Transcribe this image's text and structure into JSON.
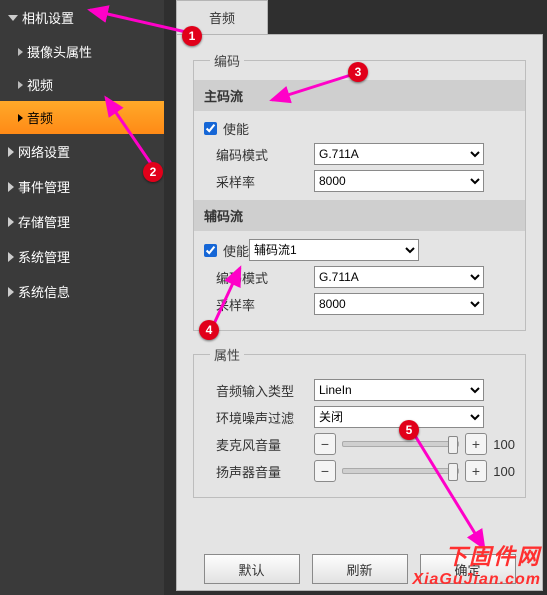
{
  "sidebar": {
    "group0": "相机设置",
    "g0c0": "摄像头属性",
    "g0c1": "视频",
    "g0c2": "音频",
    "group1": "网络设置",
    "group2": "事件管理",
    "group3": "存储管理",
    "group4": "系统管理",
    "group5": "系统信息"
  },
  "tab": {
    "audio": "音频"
  },
  "encoding": {
    "legend": "编码",
    "main": {
      "header": "主码流",
      "enable": "使能",
      "mode_label": "编码模式",
      "mode_value": "G.711A",
      "rate_label": "采样率",
      "rate_value": "8000"
    },
    "sub": {
      "header": "辅码流",
      "enable": "使能",
      "stream_value": "辅码流1",
      "mode_label": "编码模式",
      "mode_value": "G.711A",
      "rate_label": "采样率",
      "rate_value": "8000"
    }
  },
  "attrs": {
    "legend": "属性",
    "input_type_label": "音频输入类型",
    "input_type_value": "LineIn",
    "noise_label": "环境噪声过滤",
    "noise_value": "关闭",
    "mic_label": "麦克风音量",
    "mic_value": "100",
    "spk_label": "扬声器音量",
    "spk_value": "100",
    "minus": "−",
    "plus": "+"
  },
  "footer": {
    "default": "默认",
    "refresh": "刷新",
    "ok": "确定"
  },
  "markers": {
    "m1": "1",
    "m2": "2",
    "m3": "3",
    "m4": "4",
    "m5": "5"
  },
  "watermark": {
    "line1": "下固件网",
    "line2": "XiaGuJian.com"
  }
}
